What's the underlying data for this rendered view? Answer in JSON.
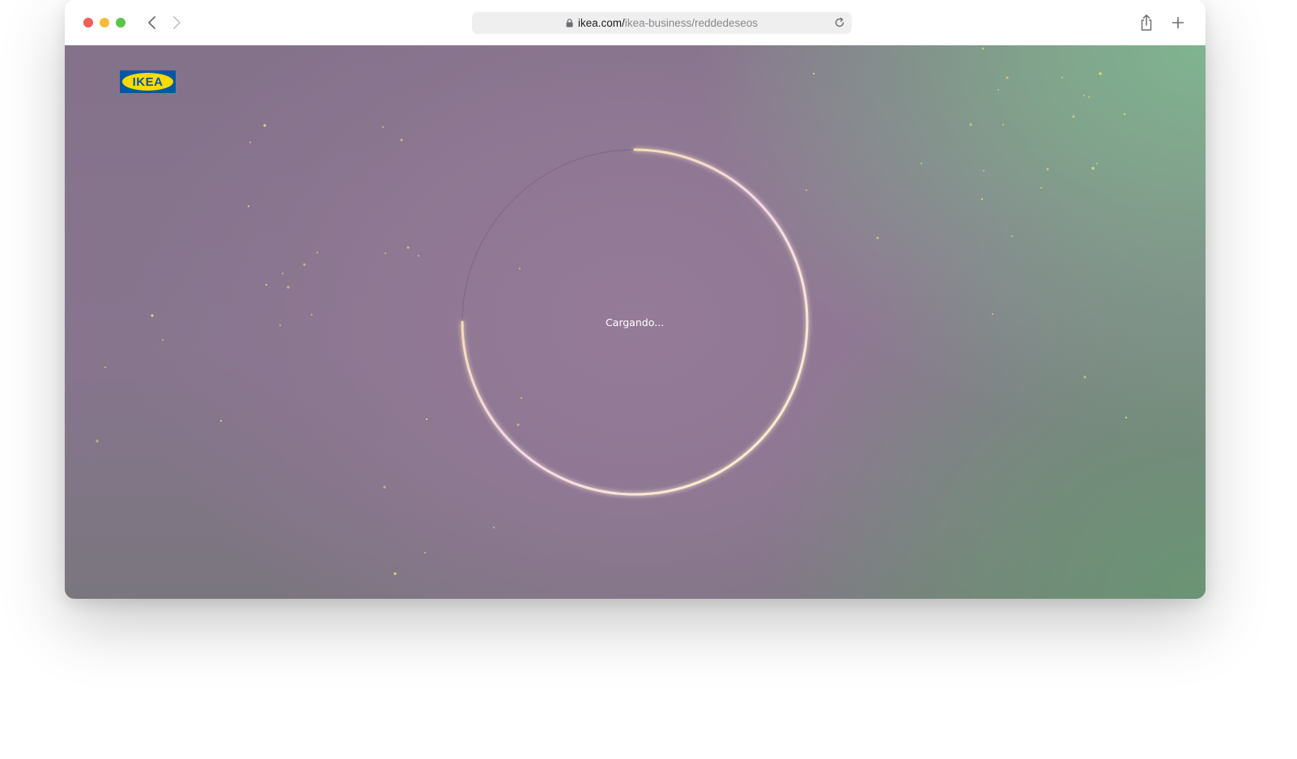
{
  "browser": {
    "url_host": "ikea.com/",
    "url_path": "ikea-business/reddedeseos",
    "icons": {
      "back": "chevron-left-icon",
      "forward": "chevron-right-icon",
      "lock": "lock-icon",
      "reload": "reload-icon",
      "share": "share-icon",
      "new_tab": "plus-icon"
    }
  },
  "page": {
    "logo_text": "IKEA",
    "loading_text": "Cargando...",
    "loading_progress": 0.75,
    "colors": {
      "logo_blue": "#0058a3",
      "logo_yellow": "#ffdb00",
      "sparkle": "#e8e27a"
    }
  }
}
